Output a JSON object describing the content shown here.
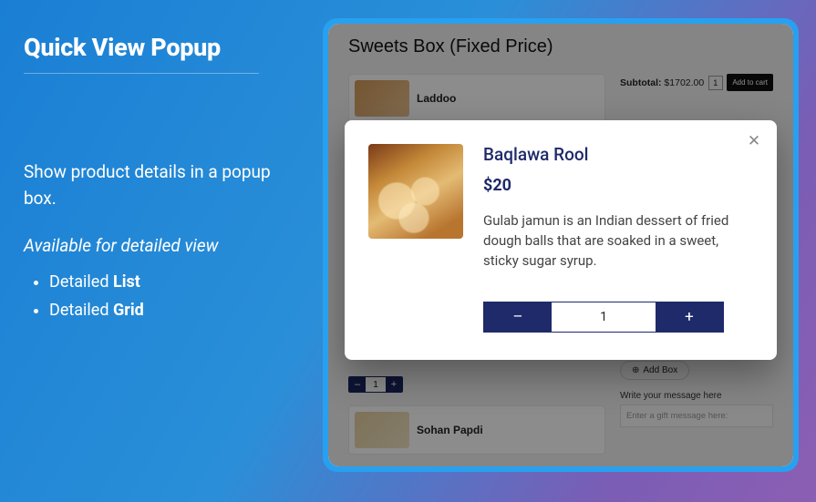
{
  "left": {
    "title": "Quick View Popup",
    "desc": "Show product details in a popup box.",
    "subhead": "Available for detailed view",
    "bullets": [
      {
        "prefix": "Detailed ",
        "strong": "List"
      },
      {
        "prefix": "Detailed ",
        "strong": "Grid"
      }
    ]
  },
  "bg": {
    "page_title": "Sweets Box (Fixed Price)",
    "products": [
      {
        "name": "Laddoo"
      },
      {
        "name": "Sohan Papdi"
      }
    ],
    "subtotal_label": "Subtotal:",
    "subtotal_value": "$1702.00",
    "cart_qty": "1",
    "add_to_cart": "Add to cart",
    "add_box": "Add Box",
    "msg_label": "Write your message here",
    "msg_placeholder": "Enter a gift message here:",
    "mini_qty": "1"
  },
  "popup": {
    "title": "Baqlawa Rool",
    "price": "$20",
    "desc": "Gulab jamun is an Indian dessert of fried dough balls that are soaked in a sweet, sticky sugar syrup.",
    "qty": "1"
  }
}
